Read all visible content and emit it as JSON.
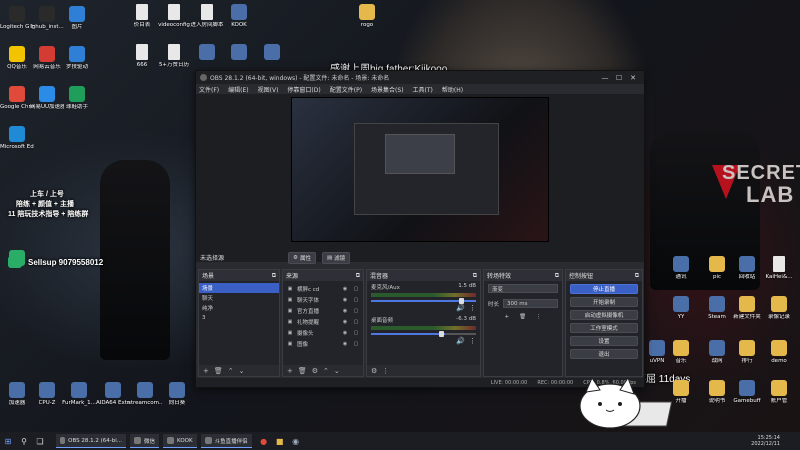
{
  "desktop": {
    "icons_left": [
      {
        "label": "Logitech G HUB",
        "icon": "logitech-icon",
        "color": "#2a2a2a"
      },
      {
        "label": "lghub_inst...",
        "icon": "logitech-installer-icon",
        "color": "#2a2a2a"
      },
      {
        "label": "图片",
        "icon": "pictures-icon",
        "color": "#2f7fd6"
      },
      {
        "label": "QQ音乐",
        "icon": "qq-music-icon",
        "color": "#f2c400"
      },
      {
        "label": "网易云音乐",
        "icon": "netease-music-icon",
        "color": "#d43c33"
      },
      {
        "label": "罗技驱动",
        "icon": "driver-icon",
        "color": "#2f7fd6"
      },
      {
        "label": "Google Chrome",
        "icon": "chrome-icon",
        "color": "#e04a3a"
      },
      {
        "label": "网易UU加速器",
        "icon": "uu-booster-icon",
        "color": "#2b8be6"
      },
      {
        "label": "球鞋助手",
        "icon": "sneaker-icon",
        "color": "#1e9e5a"
      },
      {
        "label": "Microsoft Edge",
        "icon": "edge-icon",
        "color": "#1f8ad6"
      },
      {
        "label": "",
        "icon": "wechat-icon",
        "color": "#2aae67"
      }
    ],
    "icons_top": [
      {
        "label": "价目表",
        "icon": "document-icon"
      },
      {
        "label": "videoconfig",
        "icon": "document-icon"
      },
      {
        "label": "进入房间脚本",
        "icon": "document-icon"
      },
      {
        "label": "KOOK",
        "icon": "kook-icon"
      },
      {
        "label": "rogo",
        "icon": "folder-icon"
      },
      {
        "label": "666",
        "icon": "document-icon"
      },
      {
        "label": "5+万赞日历",
        "icon": "document-icon"
      },
      {
        "label": "",
        "icon": "blue-app-icon"
      },
      {
        "label": "",
        "icon": "blue-app-icon"
      },
      {
        "label": "",
        "icon": "blue-app-icon"
      }
    ],
    "icons_right": [
      {
        "label": "通讯",
        "icon": "app-icon"
      },
      {
        "label": "pic",
        "icon": "folder-icon"
      },
      {
        "label": "回收站",
        "icon": "recycle-bin-icon"
      },
      {
        "label": "KaiHei&...",
        "icon": "document-icon"
      },
      {
        "label": "YY",
        "icon": "yy-icon"
      },
      {
        "label": "Steam",
        "icon": "steam-icon"
      },
      {
        "label": "新建文件夹",
        "icon": "folder-icon"
      },
      {
        "label": "录像记录",
        "icon": "folder-icon"
      },
      {
        "label": "uVPN",
        "icon": "vpn-icon"
      },
      {
        "label": "音乐",
        "icon": "folder-icon"
      },
      {
        "label": "战网",
        "icon": "battlenet-icon"
      },
      {
        "label": "排行",
        "icon": "folder-icon"
      },
      {
        "label": "demo",
        "icon": "folder-icon"
      },
      {
        "label": "说明书",
        "icon": "folder-icon"
      },
      {
        "label": "Gamebuff",
        "icon": "gamebuff-icon"
      },
      {
        "label": "账户管",
        "icon": "folder-icon"
      },
      {
        "label": "开播",
        "icon": "folder-icon"
      }
    ],
    "icons_bottom": [
      {
        "label": "加速器",
        "icon": "booster-icon"
      },
      {
        "label": "CPU-Z",
        "icon": "cpuz-icon"
      },
      {
        "label": "FurMark_1...",
        "icon": "furmark-icon"
      },
      {
        "label": "AIDA64 Extreme",
        "icon": "aida64-icon"
      },
      {
        "label": "streamcom... 快捷方式",
        "icon": "stream-icon"
      },
      {
        "label": "向日葵",
        "icon": "sunlogin-icon"
      }
    ],
    "overlay_top_text": "感谢上周big father:Kiikooo",
    "overlay_left_lines": [
      "上车 / 上号",
      "陪练 + 颜值 + 主播",
      "11 陪玩技术指导 + 陪练群"
    ],
    "overlay_wechat": "Sellsup 9079558012",
    "overlay_bottom_text": "坚毅不屈 11days",
    "wallpaper_brand_secret": "SECRET",
    "wallpaper_brand_lab": "LAB"
  },
  "obs": {
    "title": "OBS 28.1.2 (64-bit, windows) - 配置文件: 未命名 - 场景: 未命名",
    "menu": [
      "文件(F)",
      "编辑(E)",
      "视图(V)",
      "停靠窗口(D)",
      "配置文件(P)",
      "场景集合(S)",
      "工具(T)",
      "帮助(H)"
    ],
    "scene_bar": {
      "label": "未选择源",
      "properties_button": "属性",
      "filters_button": "滤镜"
    },
    "docks": {
      "scenes": {
        "title": "场景",
        "items": [
          "场景",
          "聊天",
          "纯净",
          "3"
        ],
        "selected_index": 0
      },
      "sources": {
        "title": "来源",
        "items": [
          "横屏c cd",
          "聊天字体",
          "官方直播",
          "礼物提醒",
          "摄像头",
          "图像"
        ]
      },
      "mixer": {
        "title": "混音器",
        "channels": [
          {
            "name": "麦克风/Aux",
            "db": "1.5 dB"
          },
          {
            "name": "桌面音频",
            "db": "-6.3 dB"
          }
        ]
      },
      "transitions": {
        "title": "转场特效",
        "type": "渐变",
        "duration_label": "时长",
        "duration": "300 ms"
      },
      "controls": {
        "title": "控制按钮",
        "buttons": [
          "停止直播",
          "开始录制",
          "启动虚拟摄像机",
          "工作室模式",
          "设置",
          "退出"
        ]
      }
    },
    "status": {
      "live": "LIVE: 00:00:00",
      "rec": "REC: 00:00:00",
      "cpu": "CPU: 0.8%, 60.00 fps"
    },
    "colors": {
      "accent": "#3a5fc5",
      "panel": "#23242a",
      "window": "#2a2b31"
    }
  },
  "taskbar": {
    "apps": [
      {
        "label": "OBS 28.1.2 (64-bi...",
        "icon": "obs-icon"
      },
      {
        "label": "微信",
        "icon": "wechat-icon"
      },
      {
        "label": "KOOK",
        "icon": "kook-icon"
      },
      {
        "label": "斗鱼直播伴侣",
        "icon": "douyu-icon"
      }
    ],
    "time": "15:25:14",
    "date": "2022/12/11"
  }
}
